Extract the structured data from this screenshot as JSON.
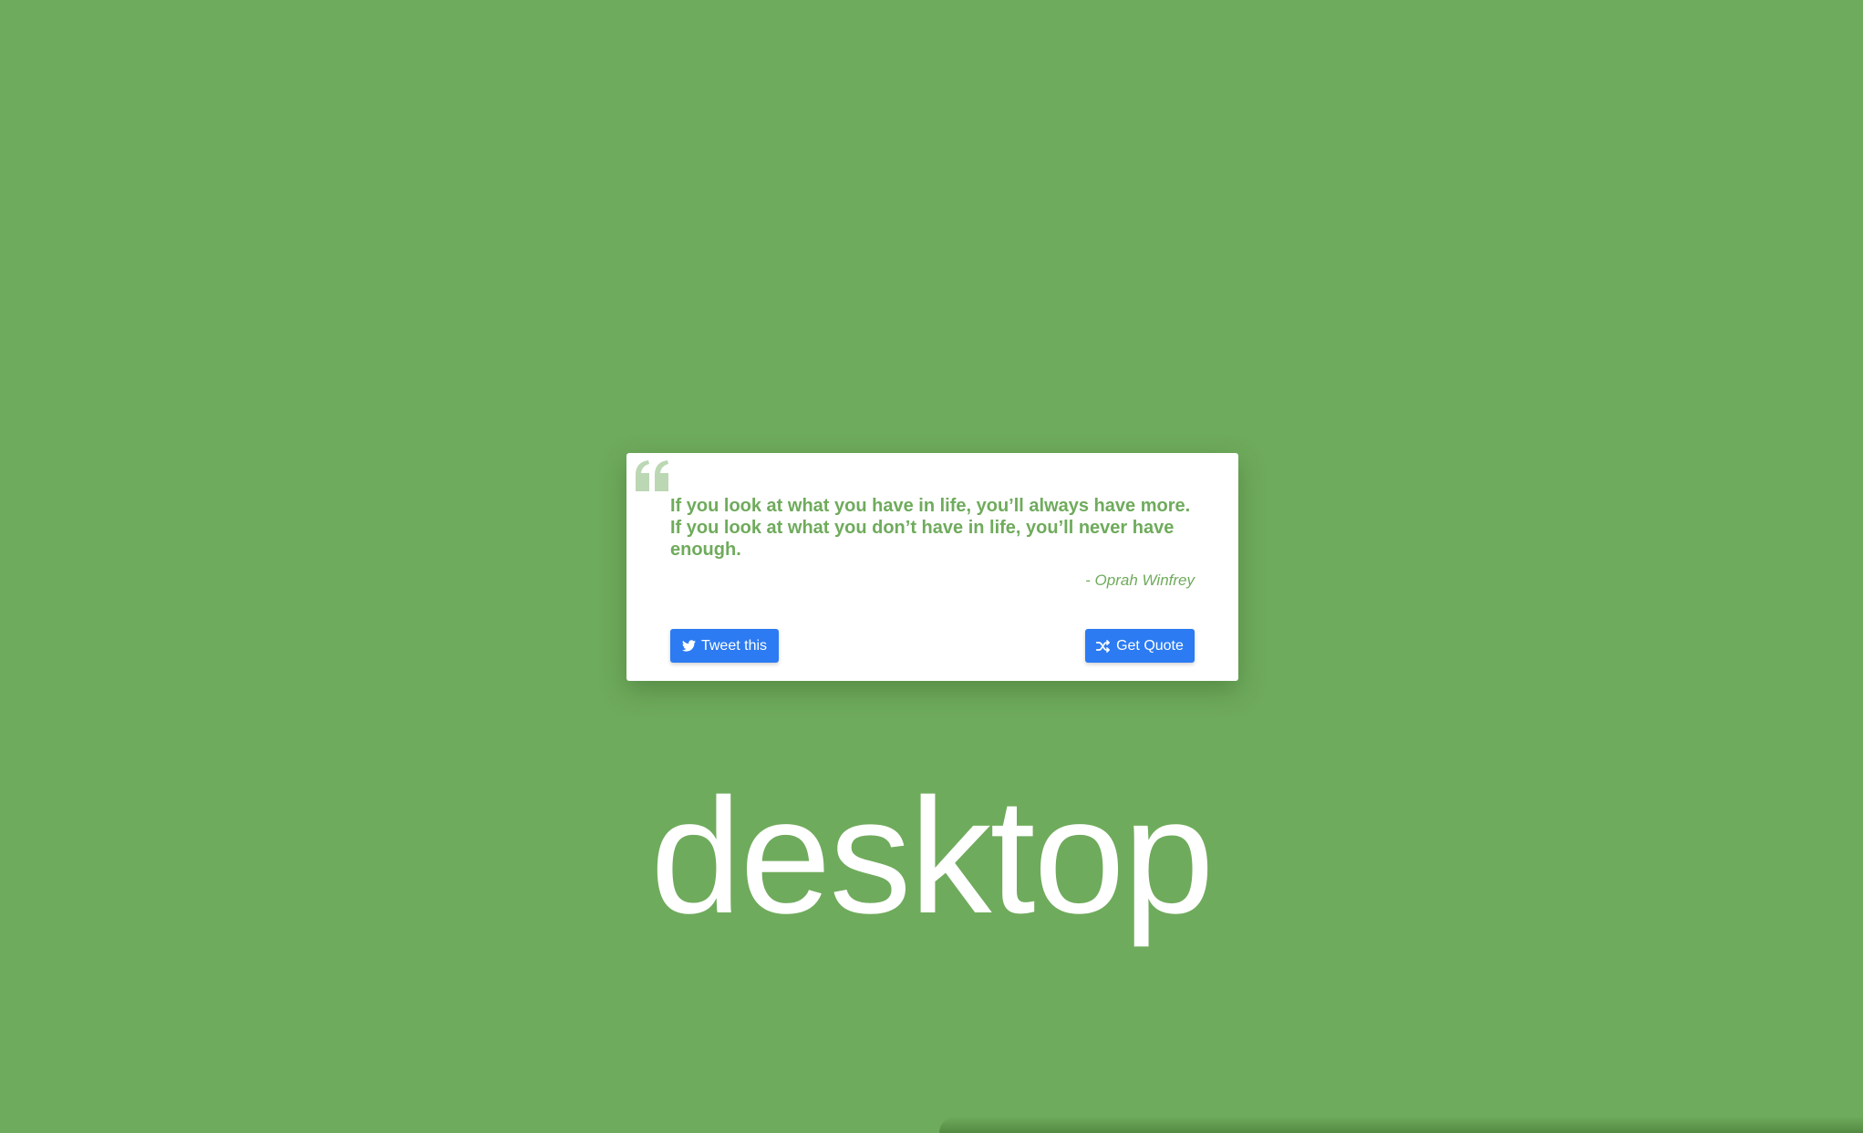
{
  "colors": {
    "background": "#6fab5c",
    "card": "#ffffff",
    "quote_text": "#6fab5c",
    "button": "#2c7bf2",
    "button_text": "#ffffff"
  },
  "quote_card": {
    "icon": "quote-left-icon",
    "text": "If you look at what you have in life, you’ll always have more. If you look at what you don’t have in life, you’ll never have enough.",
    "author": "- Oprah Winfrey",
    "tweet_button": {
      "icon": "twitter-icon",
      "label": "Tweet this"
    },
    "get_quote_button": {
      "icon": "shuffle-icon",
      "label": "Get Quote"
    }
  },
  "page_label": "desktop"
}
